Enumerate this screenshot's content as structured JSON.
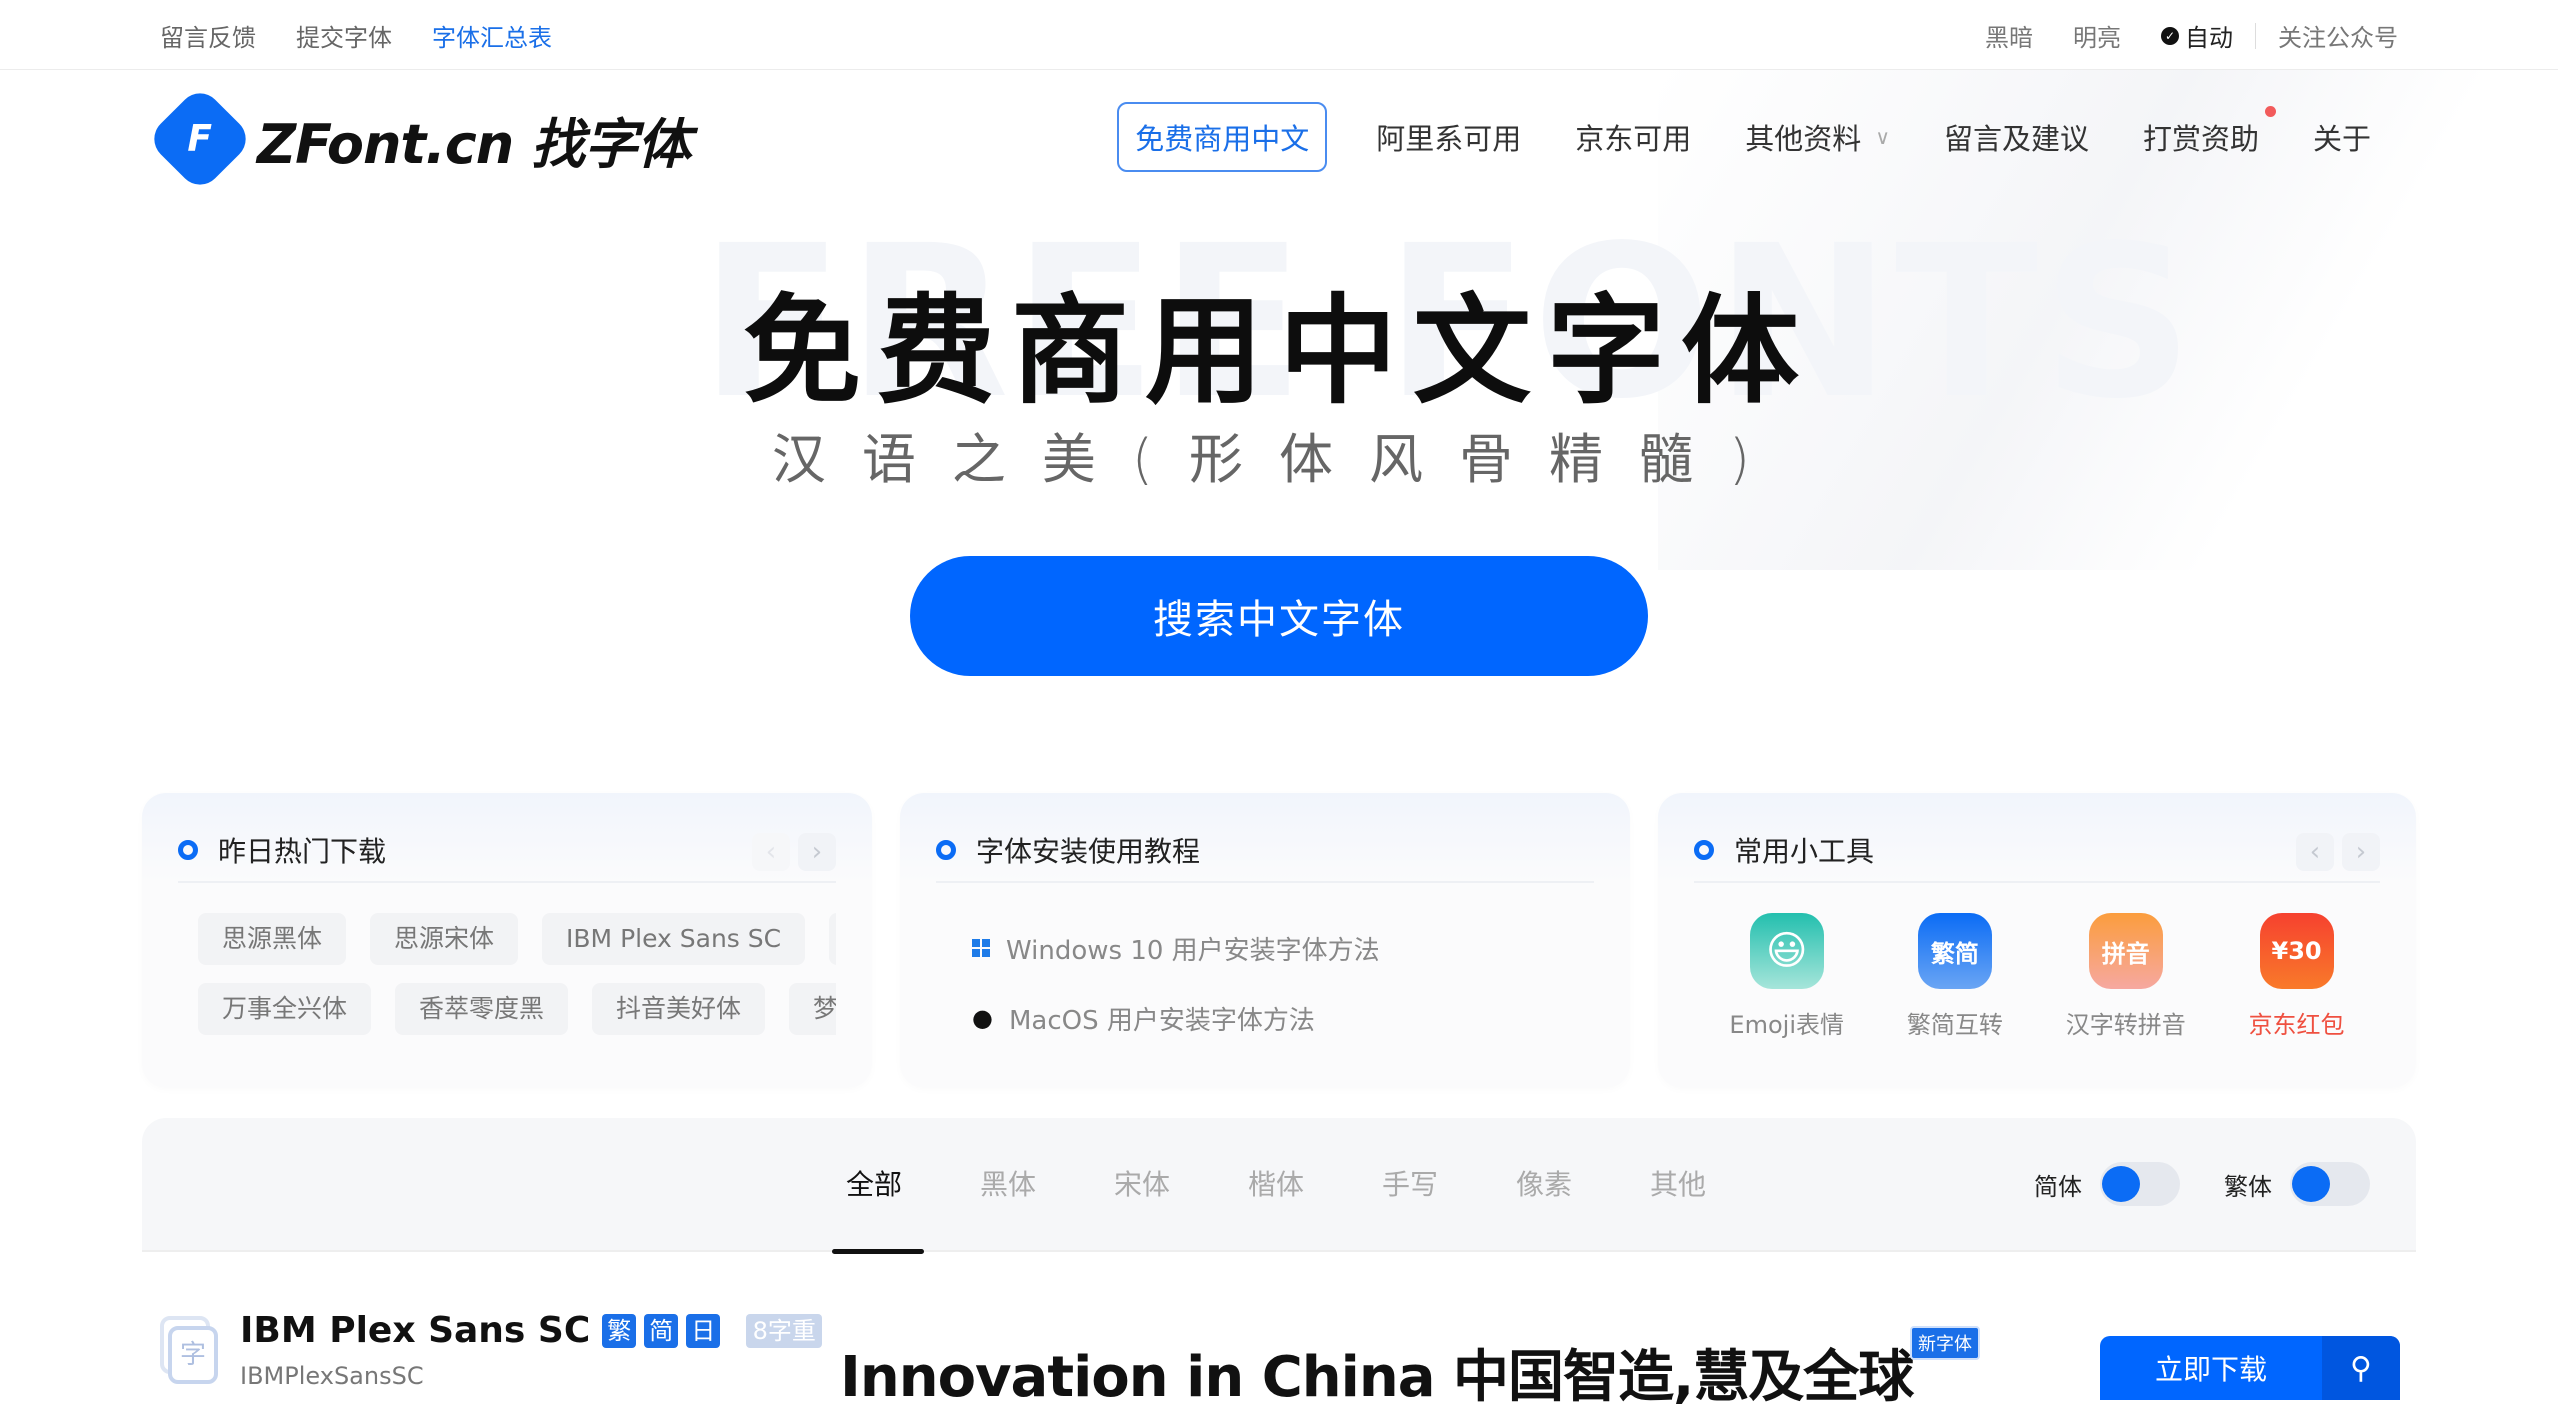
{
  "topbar": {
    "left_links": [
      {
        "label": "留言反馈",
        "active": false
      },
      {
        "label": "提交字体",
        "active": false
      },
      {
        "label": "字体汇总表",
        "active": true
      }
    ],
    "theme": {
      "dark": "黑暗",
      "light": "明亮",
      "auto": "自动",
      "auto_selected": true
    },
    "follow": "关注公众号"
  },
  "header": {
    "logo_mark": "F",
    "logo_text": "ZFont.cn 找字体",
    "nav": [
      {
        "label": "免费商用中文",
        "active": true
      },
      {
        "label": "阿里系可用"
      },
      {
        "label": "京东可用"
      },
      {
        "label": "其他资料",
        "dropdown": true
      },
      {
        "label": "留言及建议"
      },
      {
        "label": "打赏资助",
        "badge_dot": true
      },
      {
        "label": "关于"
      }
    ]
  },
  "hero": {
    "bg_text": "FREE FONTS",
    "title": "免费商用中文字体",
    "subtitle": "汉语之美(形体风骨精髓)",
    "search_button": "搜索中文字体"
  },
  "cards": {
    "hot": {
      "title": "昨日热门下载",
      "row1": [
        "思源黑体",
        "思源宋体",
        "IBM Plex Sans SC",
        "阿"
      ],
      "row2": [
        "万事全兴体",
        "香萃零度黑",
        "抖音美好体",
        "梦"
      ]
    },
    "tutorial": {
      "title": "字体安装使用教程",
      "items": [
        {
          "icon": "windows-icon",
          "label": "Windows 10 用户安装字体方法"
        },
        {
          "icon": "apple-icon",
          "label": "MacOS 用户安装字体方法"
        }
      ]
    },
    "tools": {
      "title": "常用小工具",
      "items": [
        {
          "label": "Emoji表情",
          "icon_text": "😃",
          "color": "#3cc9b5"
        },
        {
          "label": "繁简互转",
          "icon_text": "繁简",
          "color": "#2f7ff0"
        },
        {
          "label": "汉字转拼音",
          "icon_text": "拼音",
          "color": "#f79a52"
        },
        {
          "label": "京东红包",
          "icon_text": "¥30",
          "color": "#f5502f",
          "highlight": true
        }
      ]
    }
  },
  "filter": {
    "tabs": [
      "全部",
      "黑体",
      "宋体",
      "楷体",
      "手写",
      "像素",
      "其他"
    ],
    "active_tab": "全部",
    "toggles": [
      {
        "label": "简体",
        "on": false
      },
      {
        "label": "繁体",
        "on": false
      }
    ]
  },
  "font_item": {
    "name": "IBM Plex Sans SC",
    "badges": [
      "繁",
      "简",
      "日"
    ],
    "weights": "8字重",
    "id": "IBMPlexSansSC",
    "preview": "Innovation in China 中国智造,慧及全球",
    "new_tag": "新字体",
    "download": "立即下载"
  },
  "colors": {
    "accent": "#0066ff",
    "red": "#ef5040"
  }
}
